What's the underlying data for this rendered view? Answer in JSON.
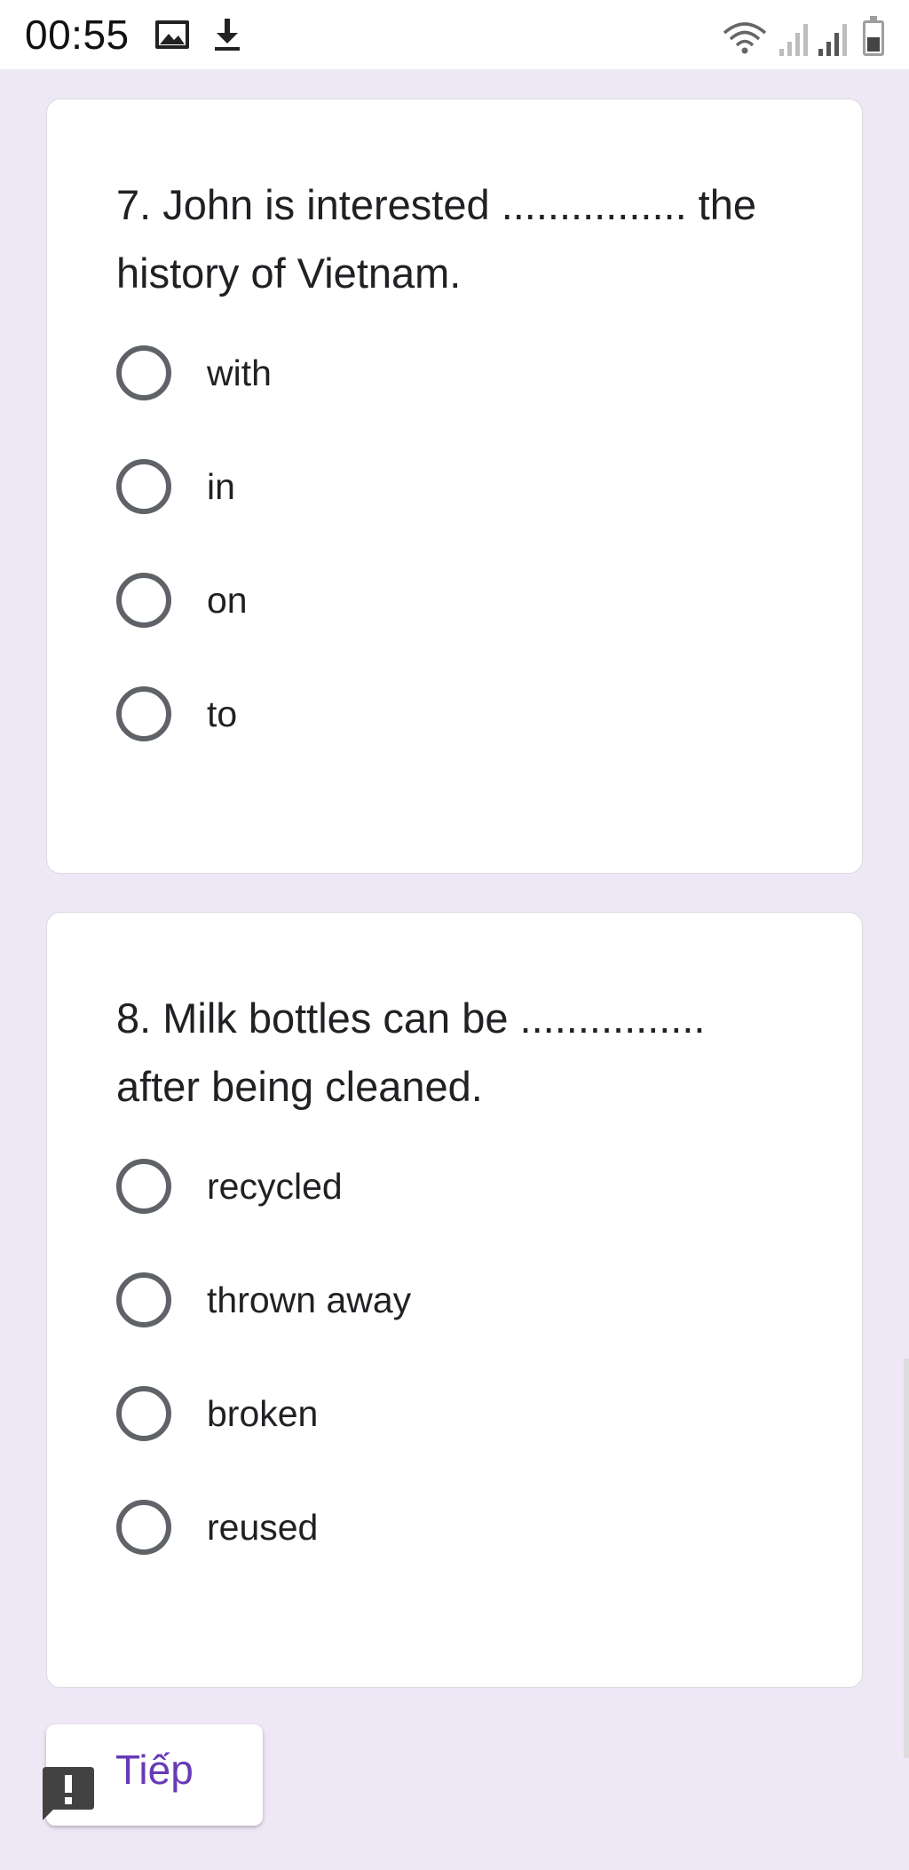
{
  "status_bar": {
    "time": "00:55",
    "icons": [
      "image-icon",
      "download-icon",
      "wifi-icon",
      "signal-icon",
      "battery-icon"
    ]
  },
  "questions": [
    {
      "text": "7. John is interested ................ the history of Vietnam.",
      "options": [
        "with",
        "in",
        "on",
        "to"
      ]
    },
    {
      "text": "8. Milk bottles can be ................ after being cleaned.",
      "options": [
        "recycled",
        "thrown away",
        "broken",
        "reused"
      ]
    }
  ],
  "next_button": {
    "label": "Tiếp"
  },
  "colors": {
    "background": "#ede7f6",
    "accent": "#673ab7",
    "radio_border": "#5f6368",
    "feedback_badge": "#424242"
  }
}
